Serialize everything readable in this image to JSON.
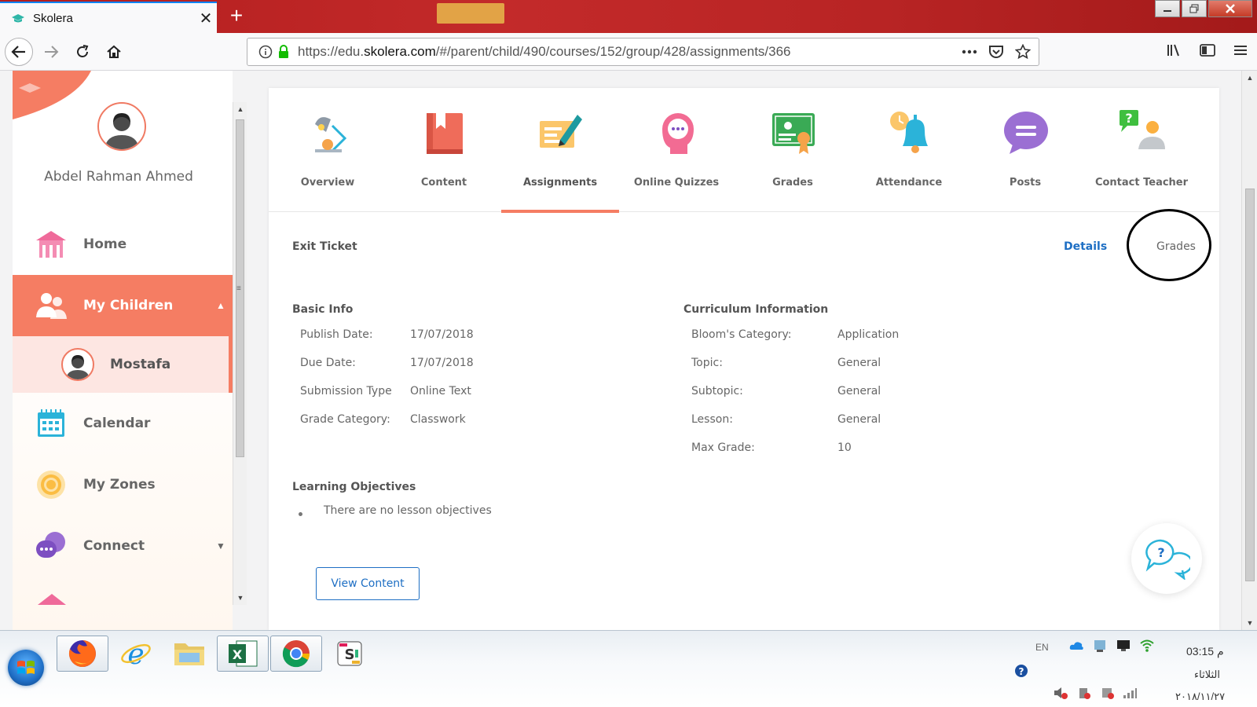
{
  "browser": {
    "tab_title": "Skolera",
    "tab_close": "✕",
    "new_tab": "+",
    "url_prefix": "https://edu.",
    "url_domain": "skolera.com",
    "url_path": "/#/parent/child/490/courses/152/group/428/assignments/366"
  },
  "sidebar": {
    "user_name": "Abdel Rahman Ahmed",
    "items": [
      {
        "label": "Home"
      },
      {
        "label": "My Children"
      },
      {
        "label": "Calendar"
      },
      {
        "label": "My Zones"
      },
      {
        "label": "Connect"
      }
    ],
    "child": {
      "label": "Mostafa"
    }
  },
  "course_tabs": [
    {
      "label": "Overview",
      "icon": "lamp-icon"
    },
    {
      "label": "Content",
      "icon": "book-icon"
    },
    {
      "label": "Assignments",
      "icon": "assignment-pen-icon"
    },
    {
      "label": "Online Quizzes",
      "icon": "quiz-head-icon"
    },
    {
      "label": "Grades",
      "icon": "certificate-icon"
    },
    {
      "label": "Attendance",
      "icon": "bell-clock-icon"
    },
    {
      "label": "Posts",
      "icon": "chat-bubble-icon"
    },
    {
      "label": "Contact Teacher",
      "icon": "question-person-icon"
    }
  ],
  "active_tab": "Assignments",
  "assignment": {
    "title": "Exit Ticket",
    "details_link": "Details",
    "grades_link": "Grades",
    "basic_info": {
      "heading": "Basic Info",
      "rows": [
        {
          "label": "Publish Date:",
          "value": "17/07/2018"
        },
        {
          "label": "Due Date:",
          "value": "17/07/2018"
        },
        {
          "label": "Submission Type",
          "value": "Online Text"
        },
        {
          "label": "Grade Category:",
          "value": "Classwork"
        }
      ]
    },
    "curriculum": {
      "heading": "Curriculum Information",
      "rows": [
        {
          "label": "Bloom's Category:",
          "value": "Application"
        },
        {
          "label": "Topic:",
          "value": "General"
        },
        {
          "label": "Subtopic:",
          "value": "General"
        },
        {
          "label": "Lesson:",
          "value": "General"
        },
        {
          "label": "Max Grade:",
          "value": "10"
        }
      ]
    },
    "objectives": {
      "heading": "Learning Objectives",
      "items": [
        "There are no lesson objectives"
      ]
    },
    "view_content_label": "View Content"
  },
  "taskbar": {
    "lang": "EN",
    "time": "03:15 م",
    "day": "الثلاثاء",
    "date": "٢٠١٨/١١/٢٧"
  },
  "colors": {
    "accent": "#f57d63",
    "link": "#1e6fc4",
    "firefox_tabstrip": "#b82424"
  }
}
